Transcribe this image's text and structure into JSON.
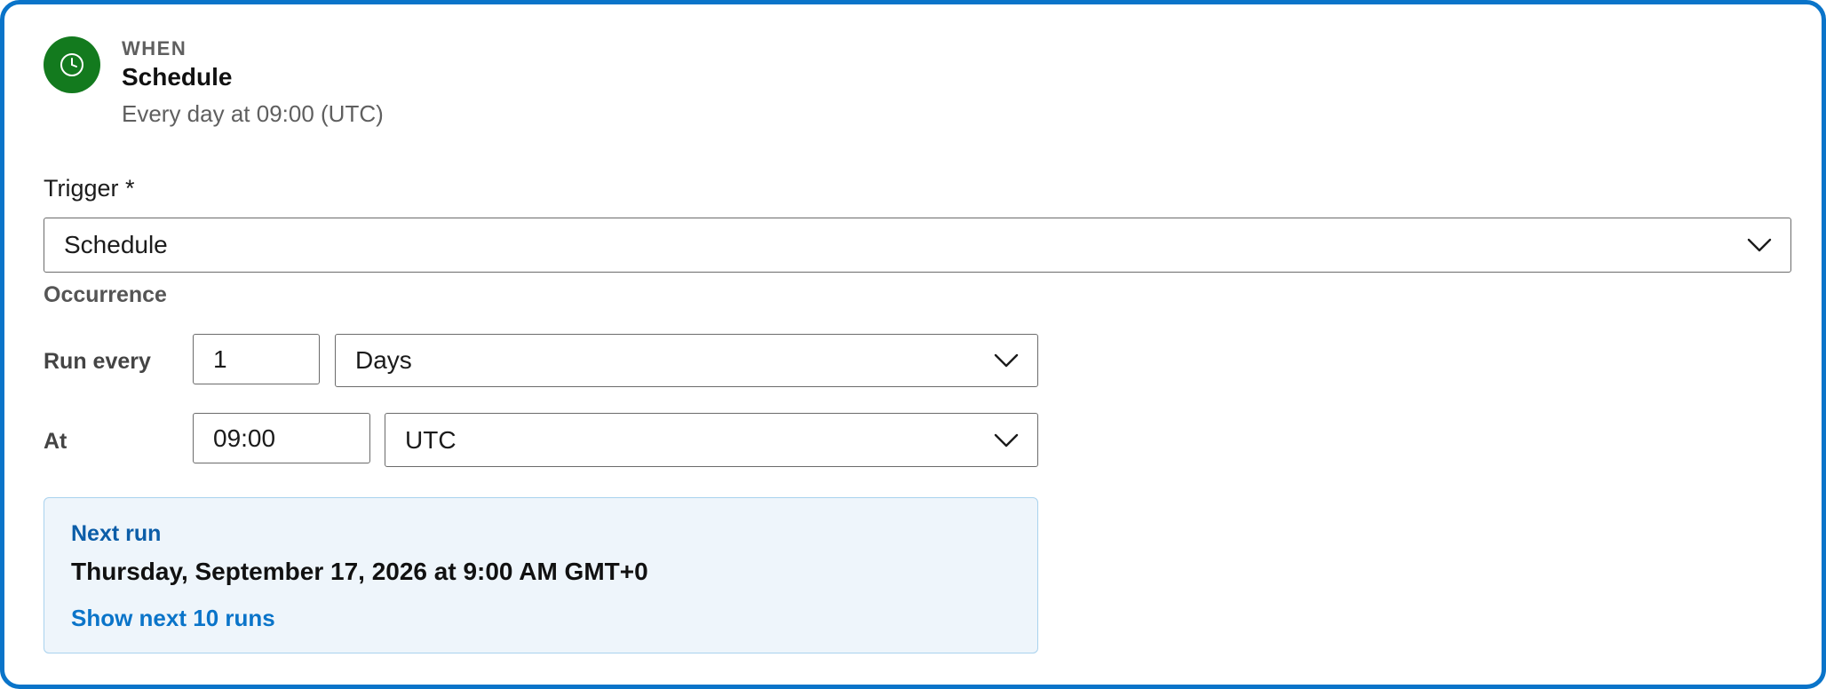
{
  "header": {
    "when_label": "WHEN",
    "title": "Schedule",
    "summary": "Every day at 09:00 (UTC)",
    "icon": "clock-icon",
    "icon_color": "#137a1e"
  },
  "trigger": {
    "label": "Trigger *",
    "selected": "Schedule"
  },
  "occurrence": {
    "section_label": "Occurrence",
    "run_every_label": "Run every",
    "interval_value": "1",
    "unit_selected": "Days",
    "at_label": "At",
    "time_value": "09:00",
    "timezone_selected": "UTC"
  },
  "next_run": {
    "title": "Next run",
    "datetime": "Thursday, September 17, 2026 at 9:00 AM GMT+0",
    "show_more_link": "Show next 10 runs"
  },
  "colors": {
    "accent": "#0a74c9",
    "panel_bg": "#eef5fb",
    "panel_border": "#a9d2ee"
  }
}
